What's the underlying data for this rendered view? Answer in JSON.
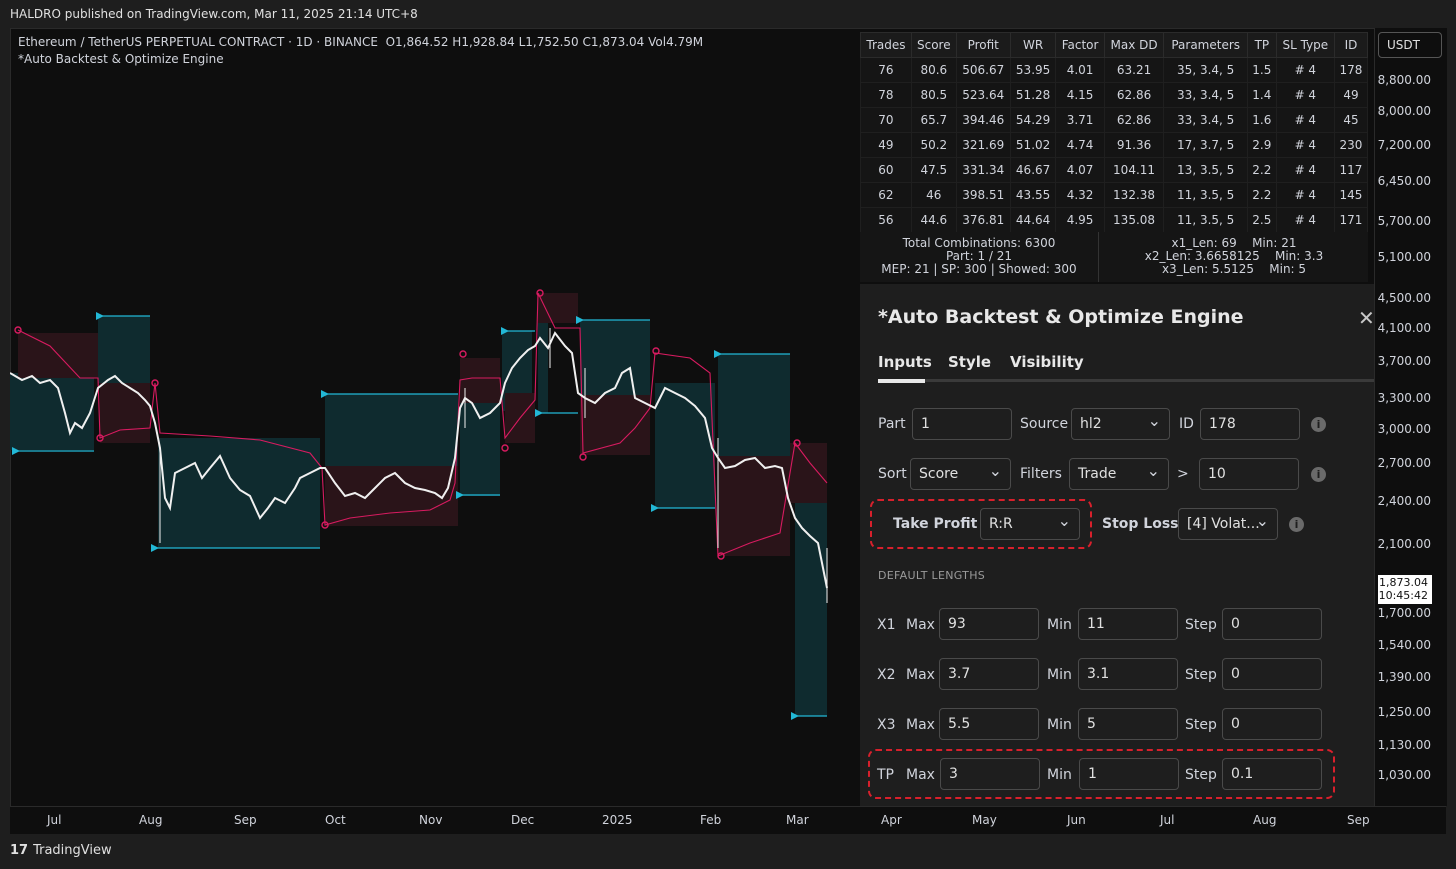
{
  "header": {
    "publisher": "HALDRO published on TradingView.com, Mar 11, 2025 21:14 UTC+8"
  },
  "legend": {
    "symbol": "Ethereum / TetherUS PERPETUAL CONTRACT · 1D · BINANCE",
    "ohlc": "O1,864.52  H1,928.84  L1,752.50  C1,873.04  Vol4.79M",
    "indicator": "*Auto Backtest & Optimize Engine"
  },
  "price_axis": {
    "currency": "USDT",
    "ticks": [
      "8,800.00",
      "8,000.00",
      "7,200.00",
      "6,450.00",
      "5,700.00",
      "5,100.00",
      "4,500.00",
      "4,100.00",
      "3,700.00",
      "3,300.00",
      "3,000.00",
      "2,700.00",
      "2,400.00",
      "2,100.00",
      "1,700.00",
      "1,540.00",
      "1,390.00",
      "1,250.00",
      "1,130.00",
      "1,030.00"
    ],
    "last_price": "1,873.04",
    "countdown": "10:45:42"
  },
  "time_axis": {
    "ticks": [
      "Jul",
      "Aug",
      "Sep",
      "Oct",
      "Nov",
      "Dec",
      "2025",
      "Feb",
      "Mar",
      "Apr",
      "May",
      "Jun",
      "Jul",
      "Aug",
      "Sep"
    ]
  },
  "results_table": {
    "headers": [
      "Trades",
      "Score",
      "Profit",
      "WR",
      "Factor",
      "Max DD",
      "Parameters",
      "TP",
      "SL Type",
      "ID"
    ],
    "rows": [
      [
        "76",
        "80.6",
        "506.67",
        "53.95",
        "4.01",
        "63.21",
        "35, 3.4, 5",
        "1.5",
        "# 4",
        "178"
      ],
      [
        "78",
        "80.5",
        "523.64",
        "51.28",
        "4.15",
        "62.86",
        "33, 3.4, 5",
        "1.4",
        "# 4",
        "49"
      ],
      [
        "70",
        "65.7",
        "394.46",
        "54.29",
        "3.71",
        "62.86",
        "33, 3.4, 5",
        "1.6",
        "# 4",
        "45"
      ],
      [
        "49",
        "50.2",
        "321.69",
        "51.02",
        "4.74",
        "91.36",
        "17, 3.7, 5",
        "2.9",
        "# 4",
        "230"
      ],
      [
        "60",
        "47.5",
        "331.34",
        "46.67",
        "4.07",
        "104.11",
        "13, 3.5, 5",
        "2.2",
        "# 4",
        "117"
      ],
      [
        "62",
        "46",
        "398.51",
        "43.55",
        "4.32",
        "132.38",
        "11, 3.5, 5",
        "2.2",
        "# 4",
        "145"
      ],
      [
        "56",
        "44.6",
        "376.81",
        "44.64",
        "4.95",
        "135.08",
        "11, 3.5, 5",
        "2.5",
        "# 4",
        "171"
      ]
    ],
    "footer_left": [
      "Total Combinations: 6300",
      "Part: 1 / 21",
      "MEP: 21 | SP: 300 | Showed: 300"
    ],
    "footer_right": [
      "x1_Len: 69    Min: 21",
      "x2_Len: 3.6658125    Min: 3.3",
      "x3_Len: 5.5125    Min: 5"
    ]
  },
  "panel": {
    "title": "*Auto Backtest & Optimize Engine",
    "tabs": [
      "Inputs",
      "Style",
      "Visibility"
    ],
    "part_label": "Part",
    "part_value": "1",
    "source_label": "Source",
    "source_value": "hl2",
    "id_label": "ID",
    "id_value": "178",
    "sort_label": "Sort",
    "sort_value": "Score",
    "filters_label": "Filters",
    "filters_value": "Trade",
    "gt_label": ">",
    "filter_threshold": "10",
    "tp_label": "Take Profit",
    "tp_value": "R:R",
    "sl_label": "Stop Loss",
    "sl_value": "[4] Volat...",
    "default_lengths": "DEFAULT LENGTHS",
    "max_label": "Max",
    "min_label": "Min",
    "step_label": "Step",
    "rows": [
      {
        "label": "X1",
        "max": "93",
        "min": "11",
        "step": "0"
      },
      {
        "label": "X2",
        "max": "3.7",
        "min": "3.1",
        "step": "0"
      },
      {
        "label": "X3",
        "max": "5.5",
        "min": "5",
        "step": "0"
      },
      {
        "label": "TP",
        "max": "3",
        "min": "1",
        "step": "0.1"
      }
    ],
    "info_glyph": "i",
    "close_glyph": "✕"
  },
  "branding": {
    "logo_mark": "17",
    "name": "TradingView"
  },
  "colors": {
    "teal": "#22b8d6",
    "magenta": "#d81b60",
    "panel_bg": "#1e1e1e",
    "highlight": "#d8202c"
  }
}
